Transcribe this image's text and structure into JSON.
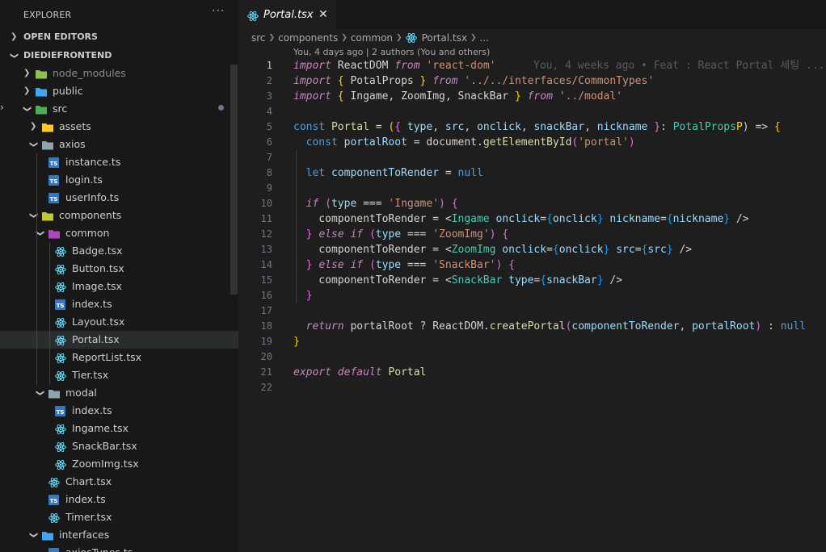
{
  "sidebar": {
    "title": "EXPLORER",
    "more": "···",
    "open_editors": "OPEN EDITORS",
    "project": "DIEDIEFRONTEND",
    "tree": [
      {
        "label": "node_modules",
        "kind": "folder",
        "depth": 1,
        "open": false,
        "icon": "folder-node-icon",
        "dim": true
      },
      {
        "label": "public",
        "kind": "folder",
        "depth": 1,
        "open": false,
        "icon": "folder-public-icon"
      },
      {
        "label": "src",
        "kind": "folder",
        "depth": 1,
        "open": true,
        "icon": "folder-src-icon"
      },
      {
        "label": "assets",
        "kind": "folder",
        "depth": 2,
        "open": false,
        "icon": "folder-assets-icon"
      },
      {
        "label": "axios",
        "kind": "folder",
        "depth": 2,
        "open": true,
        "icon": "folder-icon"
      },
      {
        "label": "instance.ts",
        "kind": "file",
        "depth": 3,
        "icon": "typescript-icon"
      },
      {
        "label": "login.ts",
        "kind": "file",
        "depth": 3,
        "icon": "typescript-icon"
      },
      {
        "label": "userInfo.ts",
        "kind": "file",
        "depth": 3,
        "icon": "typescript-icon"
      },
      {
        "label": "components",
        "kind": "folder",
        "depth": 2,
        "open": true,
        "icon": "folder-components-icon"
      },
      {
        "label": "common",
        "kind": "folder",
        "depth": 3,
        "open": true,
        "icon": "folder-common-icon"
      },
      {
        "label": "Badge.tsx",
        "kind": "file",
        "depth": 4,
        "icon": "react-icon"
      },
      {
        "label": "Button.tsx",
        "kind": "file",
        "depth": 4,
        "icon": "react-icon"
      },
      {
        "label": "Image.tsx",
        "kind": "file",
        "depth": 4,
        "icon": "react-icon"
      },
      {
        "label": "index.ts",
        "kind": "file",
        "depth": 4,
        "icon": "typescript-icon"
      },
      {
        "label": "Layout.tsx",
        "kind": "file",
        "depth": 4,
        "icon": "react-icon"
      },
      {
        "label": "Portal.tsx",
        "kind": "file",
        "depth": 4,
        "icon": "react-icon",
        "selected": true
      },
      {
        "label": "ReportList.tsx",
        "kind": "file",
        "depth": 4,
        "icon": "react-icon"
      },
      {
        "label": "Tier.tsx",
        "kind": "file",
        "depth": 4,
        "icon": "react-icon"
      },
      {
        "label": "modal",
        "kind": "folder",
        "depth": 3,
        "open": true,
        "icon": "folder-icon"
      },
      {
        "label": "index.ts",
        "kind": "file",
        "depth": 4,
        "icon": "typescript-icon"
      },
      {
        "label": "Ingame.tsx",
        "kind": "file",
        "depth": 4,
        "icon": "react-icon"
      },
      {
        "label": "SnackBar.tsx",
        "kind": "file",
        "depth": 4,
        "icon": "react-icon"
      },
      {
        "label": "ZoomImg.tsx",
        "kind": "file",
        "depth": 4,
        "icon": "react-icon"
      },
      {
        "label": "Chart.tsx",
        "kind": "file",
        "depth": 3,
        "icon": "react-icon"
      },
      {
        "label": "index.ts",
        "kind": "file",
        "depth": 3,
        "icon": "typescript-icon"
      },
      {
        "label": "Timer.tsx",
        "kind": "file",
        "depth": 3,
        "icon": "react-icon"
      },
      {
        "label": "interfaces",
        "kind": "folder",
        "depth": 2,
        "open": true,
        "icon": "folder-interfaces-icon"
      },
      {
        "label": "axiosTypes.ts",
        "kind": "file",
        "depth": 3,
        "icon": "typescript-icon"
      }
    ]
  },
  "editor": {
    "tab_label": "Portal.tsx",
    "tab_close": "✕",
    "breadcrumb": [
      "src",
      "components",
      "common",
      "Portal.tsx",
      "..."
    ],
    "blame_header": "You, 4 days ago | 2 authors (You and others)",
    "inline_blame": "You, 4 weeks ago • Feat : React Portal 세팅 ...",
    "current_line": 1,
    "lines": [
      [
        [
          "import",
          "kw"
        ],
        [
          " ReactDOM ",
          ""
        ],
        [
          "from",
          "kw"
        ],
        [
          " ",
          ""
        ],
        [
          "'react-dom'",
          "str"
        ]
      ],
      [
        [
          "import",
          "kw"
        ],
        [
          " ",
          ""
        ],
        [
          "{",
          "p1"
        ],
        [
          " PotalProps ",
          ""
        ],
        [
          "}",
          "p1"
        ],
        [
          " ",
          ""
        ],
        [
          "from",
          "kw"
        ],
        [
          " ",
          ""
        ],
        [
          "'../../interfaces/CommonTypes'",
          "str"
        ]
      ],
      [
        [
          "import",
          "kw"
        ],
        [
          " ",
          ""
        ],
        [
          "{",
          "p1"
        ],
        [
          " Ingame, ZoomImg, SnackBar ",
          ""
        ],
        [
          "}",
          "p1"
        ],
        [
          " ",
          ""
        ],
        [
          "from",
          "kw"
        ],
        [
          " ",
          ""
        ],
        [
          "'../modal'",
          "str"
        ]
      ],
      [],
      [
        [
          "const ",
          "kwb"
        ],
        [
          "Portal",
          "fn"
        ],
        [
          " = ",
          ""
        ],
        [
          "(",
          "p1"
        ],
        [
          "{",
          "p2"
        ],
        [
          " ",
          ""
        ],
        [
          "type",
          "var"
        ],
        [
          ", ",
          ""
        ],
        [
          "src",
          "var"
        ],
        [
          ", ",
          ""
        ],
        [
          "onclick",
          "var"
        ],
        [
          ", ",
          ""
        ],
        [
          "snackBar",
          "var"
        ],
        [
          ", ",
          ""
        ],
        [
          "nickname",
          "var"
        ],
        [
          " ",
          ""
        ],
        [
          "}",
          "p2"
        ],
        [
          ": ",
          ""
        ],
        [
          "PotalProps",
          "typ"
        ],
        [
          "P",
          "p1"
        ],
        [
          ") => ",
          ""
        ],
        [
          "{",
          "p1"
        ]
      ],
      [
        [
          "  const ",
          "kwb"
        ],
        [
          "portalRoot",
          "var"
        ],
        [
          " = document.",
          ""
        ],
        [
          "getElementById",
          "fn"
        ],
        [
          "(",
          "p2"
        ],
        [
          "'portal'",
          "str"
        ],
        [
          ")",
          "p2"
        ]
      ],
      [],
      [
        [
          "  let ",
          "kwb"
        ],
        [
          "componentToRender",
          "var"
        ],
        [
          " = ",
          ""
        ],
        [
          "null",
          "kwb"
        ]
      ],
      [],
      [
        [
          "  if ",
          "kw"
        ],
        [
          "(",
          "p2"
        ],
        [
          "type",
          "var"
        ],
        [
          " === ",
          ""
        ],
        [
          "'Ingame'",
          "str"
        ],
        [
          ")",
          "p2"
        ],
        [
          " ",
          ""
        ],
        [
          "{",
          "p2"
        ]
      ],
      [
        [
          "    componentToRender = <",
          ""
        ],
        [
          "Ingame",
          "typ"
        ],
        [
          " ",
          ""
        ],
        [
          "onclick",
          "var"
        ],
        [
          "=",
          ""
        ],
        [
          "{",
          "p3"
        ],
        [
          "onclick",
          "var"
        ],
        [
          "}",
          "p3"
        ],
        [
          " ",
          ""
        ],
        [
          "nickname",
          "var"
        ],
        [
          "=",
          ""
        ],
        [
          "{",
          "p3"
        ],
        [
          "nickname",
          "var"
        ],
        [
          "}",
          "p3"
        ],
        [
          " />",
          ""
        ]
      ],
      [
        [
          "  ",
          ""
        ],
        [
          "}",
          "p2"
        ],
        [
          " ",
          ""
        ],
        [
          "else if ",
          "kw"
        ],
        [
          "(",
          "p2"
        ],
        [
          "type",
          "var"
        ],
        [
          " === ",
          ""
        ],
        [
          "'ZoomImg'",
          "str"
        ],
        [
          ")",
          "p2"
        ],
        [
          " ",
          ""
        ],
        [
          "{",
          "p2"
        ]
      ],
      [
        [
          "    componentToRender = <",
          ""
        ],
        [
          "ZoomImg",
          "typ"
        ],
        [
          " ",
          ""
        ],
        [
          "onclick",
          "var"
        ],
        [
          "=",
          ""
        ],
        [
          "{",
          "p3"
        ],
        [
          "onclick",
          "var"
        ],
        [
          "}",
          "p3"
        ],
        [
          " ",
          ""
        ],
        [
          "src",
          "var"
        ],
        [
          "=",
          ""
        ],
        [
          "{",
          "p3"
        ],
        [
          "src",
          "var"
        ],
        [
          "}",
          "p3"
        ],
        [
          " />",
          ""
        ]
      ],
      [
        [
          "  ",
          ""
        ],
        [
          "}",
          "p2"
        ],
        [
          " ",
          ""
        ],
        [
          "else if ",
          "kw"
        ],
        [
          "(",
          "p2"
        ],
        [
          "type",
          "var"
        ],
        [
          " === ",
          ""
        ],
        [
          "'SnackBar'",
          "str"
        ],
        [
          ")",
          "p2"
        ],
        [
          " ",
          ""
        ],
        [
          "{",
          "p2"
        ]
      ],
      [
        [
          "    componentToRender = <",
          ""
        ],
        [
          "SnackBar",
          "typ"
        ],
        [
          " ",
          ""
        ],
        [
          "type",
          "var"
        ],
        [
          "=",
          ""
        ],
        [
          "{",
          "p3"
        ],
        [
          "snackBar",
          "var"
        ],
        [
          "}",
          "p3"
        ],
        [
          " />",
          ""
        ]
      ],
      [
        [
          "  ",
          ""
        ],
        [
          "}",
          "p2"
        ]
      ],
      [],
      [
        [
          "  return ",
          "kw"
        ],
        [
          "portalRoot ? ReactDOM.",
          ""
        ],
        [
          "createPortal",
          "fn"
        ],
        [
          "(",
          "p2"
        ],
        [
          "componentToRender, portalRoot",
          "var"
        ],
        [
          ")",
          "p2"
        ],
        [
          " : ",
          ""
        ],
        [
          "null",
          "kwb"
        ]
      ],
      [
        [
          "}",
          "p1"
        ]
      ],
      [],
      [
        [
          "export ",
          "kw"
        ],
        [
          "default ",
          "kw"
        ],
        [
          "Portal",
          "fn"
        ]
      ],
      []
    ]
  },
  "colors": {
    "editor_bg": "#1e1e1e",
    "sidebar_bg": "#181818",
    "keyword": "#c586c0",
    "string": "#ce9178",
    "function": "#dcdcaa",
    "variable": "#9cdcfe",
    "type": "#4ec9b0"
  }
}
